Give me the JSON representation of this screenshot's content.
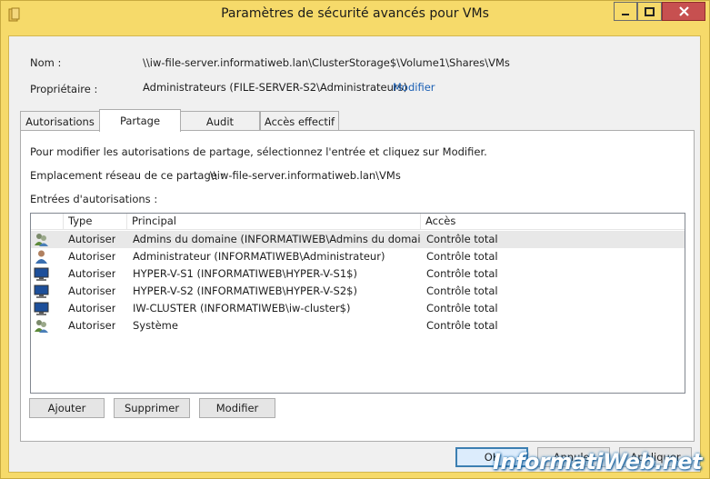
{
  "window": {
    "title": "Paramètres de sécurité avancés pour VMs",
    "accent_color": "#f6da6a"
  },
  "header": {
    "name_label": "Nom :",
    "name_value": "\\\\iw-file-server.informatiweb.lan\\ClusterStorage$\\Volume1\\Shares\\VMs",
    "owner_label": "Propriétaire :",
    "owner_value": "Administrateurs (FILE-SERVER-S2\\Administrateurs)",
    "owner_modify_link": "Modifier"
  },
  "tabs": [
    {
      "label": "Autorisations",
      "active": false
    },
    {
      "label": "Partage",
      "active": true
    },
    {
      "label": "Audit",
      "active": false
    },
    {
      "label": "Accès effectif",
      "active": false
    }
  ],
  "panel": {
    "instruction": "Pour modifier les autorisations de partage, sélectionnez l'entrée et cliquez sur Modifier.",
    "network_location_label": "Emplacement réseau de ce partage :",
    "network_location_value": "\\\\iw-file-server.informatiweb.lan\\VMs",
    "entries_label": "Entrées d'autorisations :"
  },
  "table": {
    "columns": [
      "Type",
      "Principal",
      "Accès"
    ],
    "rows": [
      {
        "icon": "group-icon",
        "type": "Autoriser",
        "principal": "Admins du domaine (INFORMATIWEB\\Admins du domai...",
        "access": "Contrôle total",
        "selected": true
      },
      {
        "icon": "user-icon",
        "type": "Autoriser",
        "principal": "Administrateur (INFORMATIWEB\\Administrateur)",
        "access": "Contrôle total",
        "selected": false
      },
      {
        "icon": "computer-icon",
        "type": "Autoriser",
        "principal": "HYPER-V-S1 (INFORMATIWEB\\HYPER-V-S1$)",
        "access": "Contrôle total",
        "selected": false
      },
      {
        "icon": "computer-icon",
        "type": "Autoriser",
        "principal": "HYPER-V-S2 (INFORMATIWEB\\HYPER-V-S2$)",
        "access": "Contrôle total",
        "selected": false
      },
      {
        "icon": "computer-icon",
        "type": "Autoriser",
        "principal": "IW-CLUSTER (INFORMATIWEB\\iw-cluster$)",
        "access": "Contrôle total",
        "selected": false
      },
      {
        "icon": "group-icon",
        "type": "Autoriser",
        "principal": "Système",
        "access": "Contrôle total",
        "selected": false
      }
    ]
  },
  "panel_buttons": {
    "add": "Ajouter",
    "remove": "Supprimer",
    "modify": "Modifier"
  },
  "dialog_buttons": {
    "ok": "OK",
    "cancel": "Annuler",
    "apply": "Appliquer"
  },
  "watermark": "InformatiWeb.net"
}
